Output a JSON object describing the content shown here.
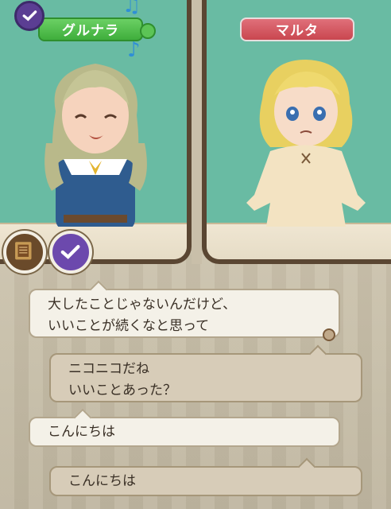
{
  "characters": {
    "left": {
      "name": "グルナラ",
      "plate_color": "#4bb848"
    },
    "right": {
      "name": "マルタ",
      "plate_color": "#d45a63"
    }
  },
  "icons": {
    "top_badge": "checkmark-icon",
    "purple_badge": "checkmark-icon",
    "book_badge": "book-icon",
    "music": "music-note-icon",
    "scroll": "scroll-marker-icon"
  },
  "dialogue": [
    {
      "speaker": "right",
      "style": "light",
      "lines": [
        "大したことじゃないんだけど、",
        "いいことが続くなと思って"
      ]
    },
    {
      "speaker": "left",
      "style": "dark",
      "lines": [
        "ニコニコだね",
        "いいことあった？"
      ]
    },
    {
      "speaker": "right",
      "style": "light",
      "lines": [
        "こんにちは"
      ]
    },
    {
      "speaker": "left",
      "style": "dark",
      "lines": [
        "こんにちは"
      ]
    }
  ],
  "colors": {
    "panel_bg": "#69bba3",
    "frame": "#5a4632",
    "bubble_light": "#f4f1e8",
    "bubble_dark": "#d7ccb8"
  }
}
